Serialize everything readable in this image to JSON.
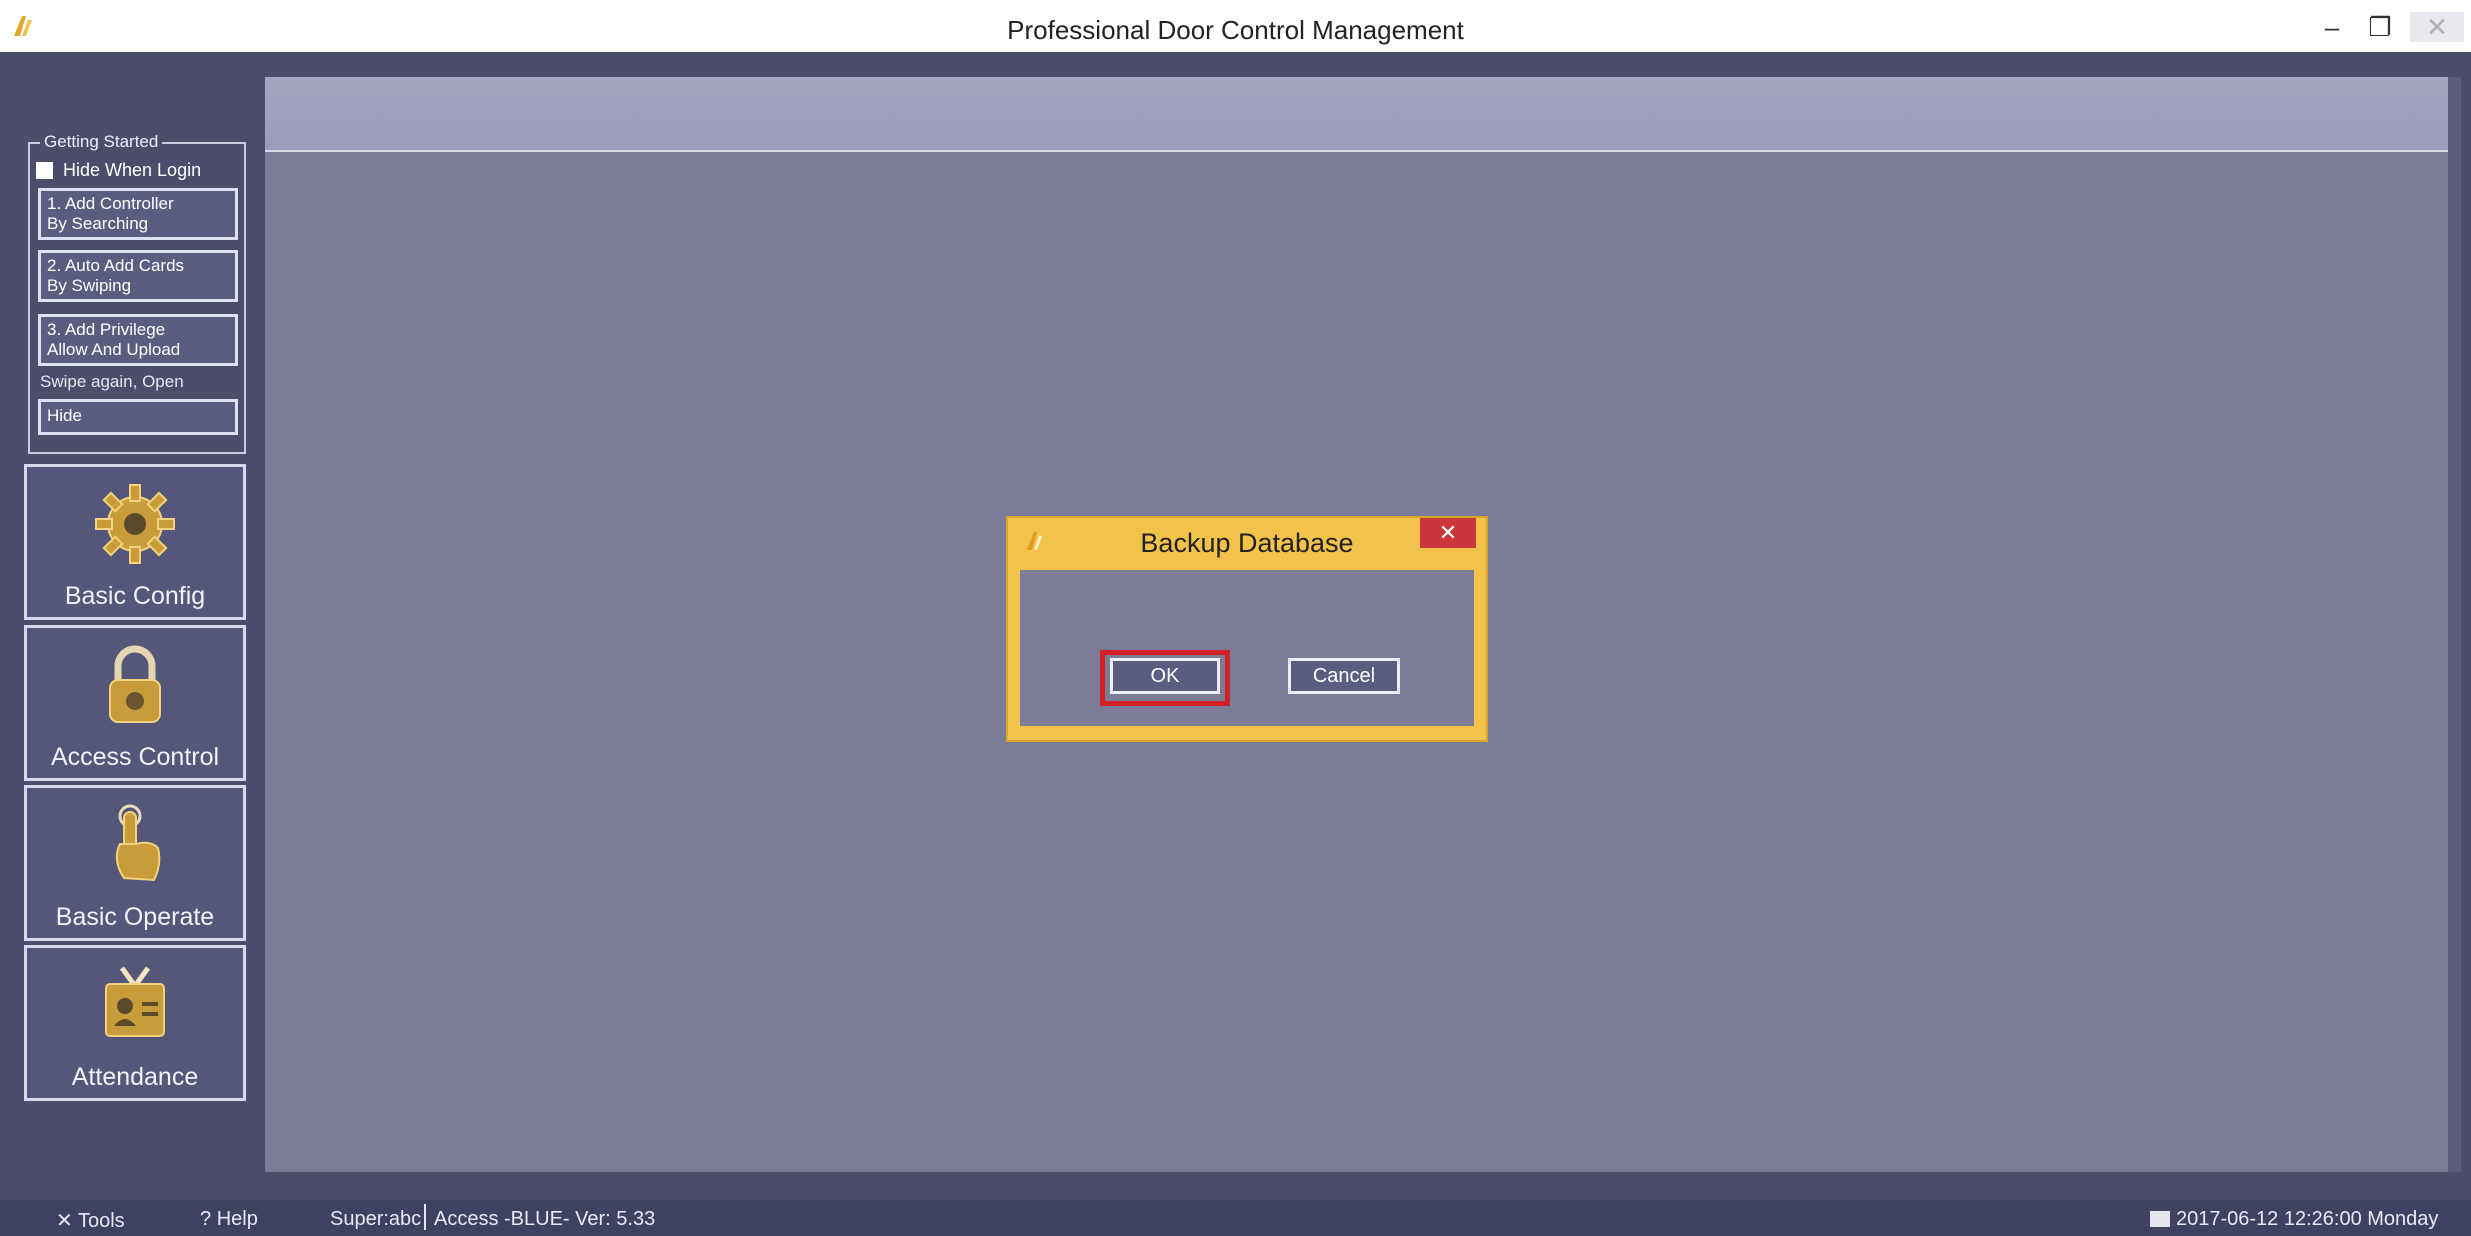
{
  "window": {
    "title": "Professional Door Control Management",
    "minimize": "–",
    "restore": "❐",
    "close": "✕"
  },
  "getting_started": {
    "legend": "Getting Started",
    "hide_when_login": "Hide When Login",
    "steps": [
      {
        "line1": "1. Add Controller",
        "line2": "By Searching"
      },
      {
        "line1": "2. Auto Add Cards",
        "line2": "By Swiping"
      },
      {
        "line1": "3. Add Privilege",
        "line2": "Allow And Upload"
      }
    ],
    "note": "Swipe again, Open",
    "hide_label": "Hide"
  },
  "modules": [
    {
      "label": "Basic Config",
      "icon": "gear-icon"
    },
    {
      "label": "Access Control",
      "icon": "padlock-icon"
    },
    {
      "label": "Basic Operate",
      "icon": "hand-pointer-icon"
    },
    {
      "label": "Attendance",
      "icon": "id-card-icon"
    }
  ],
  "dialog": {
    "title": "Backup Database",
    "close": "✕",
    "ok_label": "OK",
    "cancel_label": "Cancel"
  },
  "statusbar": {
    "tools": "Tools",
    "help": "Help",
    "user": "Super:abc",
    "version": "Access -BLUE- Ver: 5.33",
    "datetime": "2017-06-12 12:26:00 Monday"
  },
  "colors": {
    "frame": "#4b4d6b",
    "workspace": "#7b7c98",
    "dialog_border": "#f2c24a",
    "highlight": "#d42027"
  }
}
